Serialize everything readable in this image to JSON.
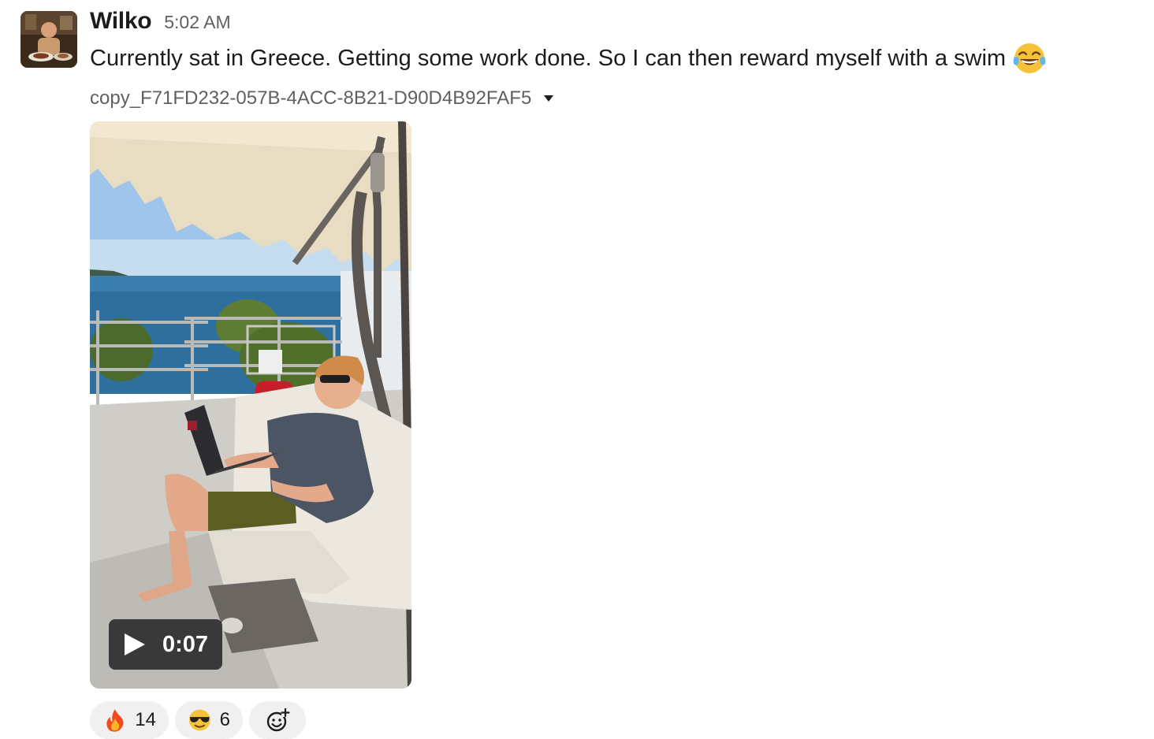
{
  "message": {
    "author": "Wilko",
    "time": "5:02 AM",
    "text": "Currently sat in Greece. Getting some work done. So I can then reward myself with a swim",
    "text_emoji": "joy-emoji"
  },
  "attachment": {
    "file_name": "copy_F71FD232-057B-4ACC-8B21-D90D4B92FAF5",
    "type": "video",
    "duration": "0:07"
  },
  "reactions": [
    {
      "emoji": "fire-emoji",
      "count": "14"
    },
    {
      "emoji": "sunglasses-emoji",
      "count": "6"
    }
  ],
  "icons": {
    "add_reaction": "add-reaction-icon",
    "expand": "caret-down-icon",
    "play": "play-icon"
  },
  "colors": {
    "text": "#1d1c1d",
    "muted": "#616061",
    "reaction_bg": "#f0f0f0"
  }
}
